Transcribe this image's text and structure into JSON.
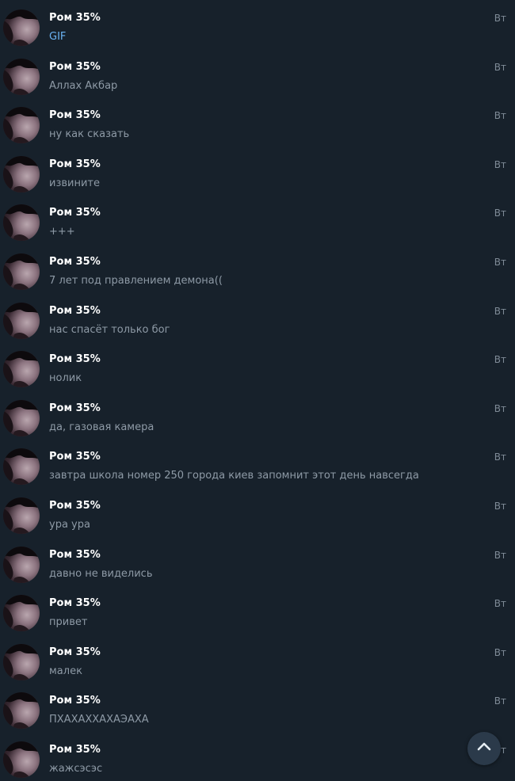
{
  "chat_list": {
    "items": [
      {
        "sender": "Ром 35%",
        "message": "GIF",
        "time": "Вт",
        "media": true
      },
      {
        "sender": "Ром 35%",
        "message": "Аллах Акбар",
        "time": "Вт"
      },
      {
        "sender": "Ром 35%",
        "message": "ну как сказать",
        "time": "Вт"
      },
      {
        "sender": "Ром 35%",
        "message": "извините",
        "time": "Вт"
      },
      {
        "sender": "Ром 35%",
        "message": "+++",
        "time": "Вт"
      },
      {
        "sender": "Ром 35%",
        "message": "7 лет под правлением демона((",
        "time": "Вт"
      },
      {
        "sender": "Ром 35%",
        "message": "нас спасёт только бог",
        "time": "Вт"
      },
      {
        "sender": "Ром 35%",
        "message": "нолик",
        "time": "Вт"
      },
      {
        "sender": "Ром 35%",
        "message": "да, газовая камера",
        "time": "Вт"
      },
      {
        "sender": "Ром 35%",
        "message": "завтра школа номер 250 города киев запомнит этот день навсегда",
        "time": "Вт"
      },
      {
        "sender": "Ром 35%",
        "message": "ура ура",
        "time": "Вт"
      },
      {
        "sender": "Ром 35%",
        "message": "давно не виделись",
        "time": "Вт"
      },
      {
        "sender": "Ром 35%",
        "message": "привет",
        "time": "Вт"
      },
      {
        "sender": "Ром 35%",
        "message": "малек",
        "time": "Вт"
      },
      {
        "sender": "Ром 35%",
        "message": "ПХАХАХХАХАЭАХА",
        "time": "Вт"
      },
      {
        "sender": "Ром 35%",
        "message": "жажсэсэс",
        "time": "Вт"
      }
    ]
  },
  "scroll_to_top": {
    "icon": "chevron-up-icon"
  },
  "colors": {
    "background": "#17212b",
    "sender": "#ffffff",
    "message": "#8e9aa6",
    "media_link": "#6ab2f2",
    "time": "#7f8b97",
    "scroll_button": "#2b3a4a"
  }
}
